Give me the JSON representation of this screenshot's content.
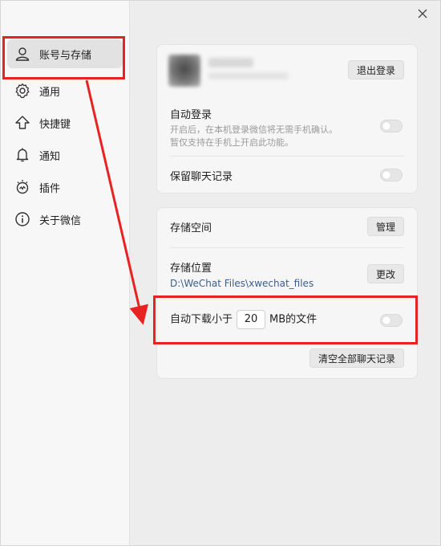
{
  "sidebar": {
    "items": [
      {
        "label": "账号与存储",
        "icon": "person-icon"
      },
      {
        "label": "通用",
        "icon": "gear-icon"
      },
      {
        "label": "快捷键",
        "icon": "shortcut-arrow-icon"
      },
      {
        "label": "通知",
        "icon": "bell-icon"
      },
      {
        "label": "插件",
        "icon": "plugin-icon"
      },
      {
        "label": "关于微信",
        "icon": "info-icon"
      }
    ]
  },
  "account_card": {
    "logout_label": "退出登录",
    "auto_login": {
      "title": "自动登录",
      "desc_line1": "开启后，在本机登录微信将无需手机确认。",
      "desc_line2": "暂仅支持在手机上开启此功能。"
    },
    "keep_history": {
      "title": "保留聊天记录"
    }
  },
  "storage_card": {
    "space": {
      "title": "存储空间",
      "button": "管理"
    },
    "location": {
      "title": "存储位置",
      "path": "D:\\WeChat Files\\xwechat_files",
      "button": "更改"
    },
    "auto_download": {
      "prefix": "自动下载小于",
      "value": "20",
      "suffix": "MB的文件"
    },
    "clear_button": "清空全部聊天记录"
  },
  "colors": {
    "highlight": "#e82222"
  }
}
